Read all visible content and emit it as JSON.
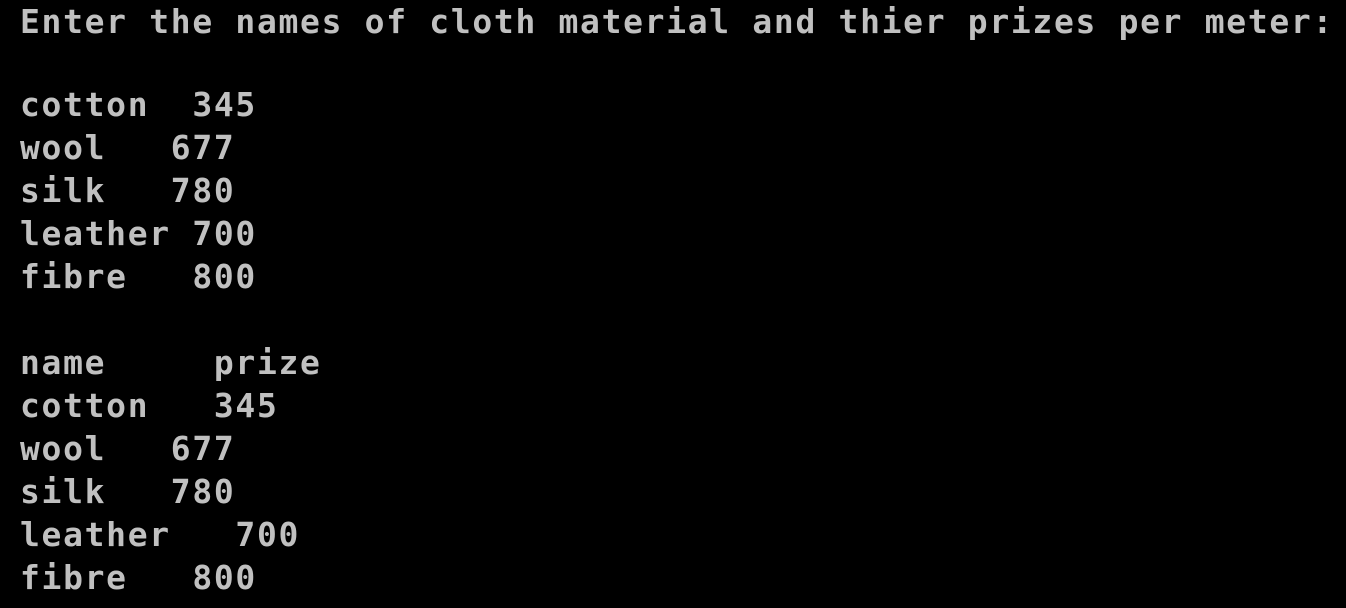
{
  "terminal": {
    "prompt": "Enter the names of cloth material and thier prizes per meter:",
    "input_rows": [
      {
        "name": "cotton",
        "prize": "345",
        "text": "cotton  345"
      },
      {
        "name": "wool",
        "prize": "677",
        "text": "wool   677"
      },
      {
        "name": "silk",
        "prize": "780",
        "text": "silk   780"
      },
      {
        "name": "leather",
        "prize": "700",
        "text": "leather 700"
      },
      {
        "name": "fibre",
        "prize": "800",
        "text": "fibre   800"
      }
    ],
    "table_header": {
      "name_label": "name",
      "prize_label": "prize",
      "text": "name     prize"
    },
    "output_rows": [
      {
        "name": "cotton",
        "prize": "345",
        "text": "cotton   345"
      },
      {
        "name": "wool",
        "prize": "677",
        "text": "wool   677"
      },
      {
        "name": "silk",
        "prize": "780",
        "text": "silk   780"
      },
      {
        "name": "leather",
        "prize": "700",
        "text": "leather   700"
      },
      {
        "name": "fibre",
        "prize": "800",
        "text": "fibre   800"
      }
    ],
    "colors": {
      "background": "#000000",
      "foreground": "#c0c0c0"
    }
  }
}
